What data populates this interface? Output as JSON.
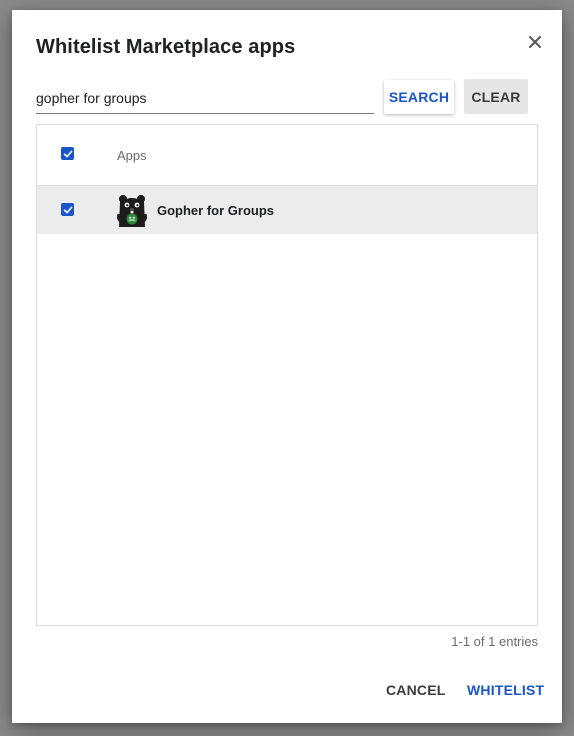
{
  "dialog": {
    "title": "Whitelist Marketplace apps",
    "close_icon": "close-icon"
  },
  "search": {
    "value": "gopher for groups",
    "search_label": "SEARCH",
    "clear_label": "CLEAR"
  },
  "table": {
    "header_checked": true,
    "columns": [
      "Apps"
    ],
    "rows": [
      {
        "checked": true,
        "name": "Gopher for Groups",
        "icon": "gopher-app-icon"
      }
    ],
    "entries_text": "1-1 of 1 entries"
  },
  "footer": {
    "cancel_label": "CANCEL",
    "whitelist_label": "WHITELIST"
  },
  "colors": {
    "accent": "#1a56c7",
    "row_selected_bg": "#ececec",
    "clear_button_bg": "#e6e6e6"
  }
}
